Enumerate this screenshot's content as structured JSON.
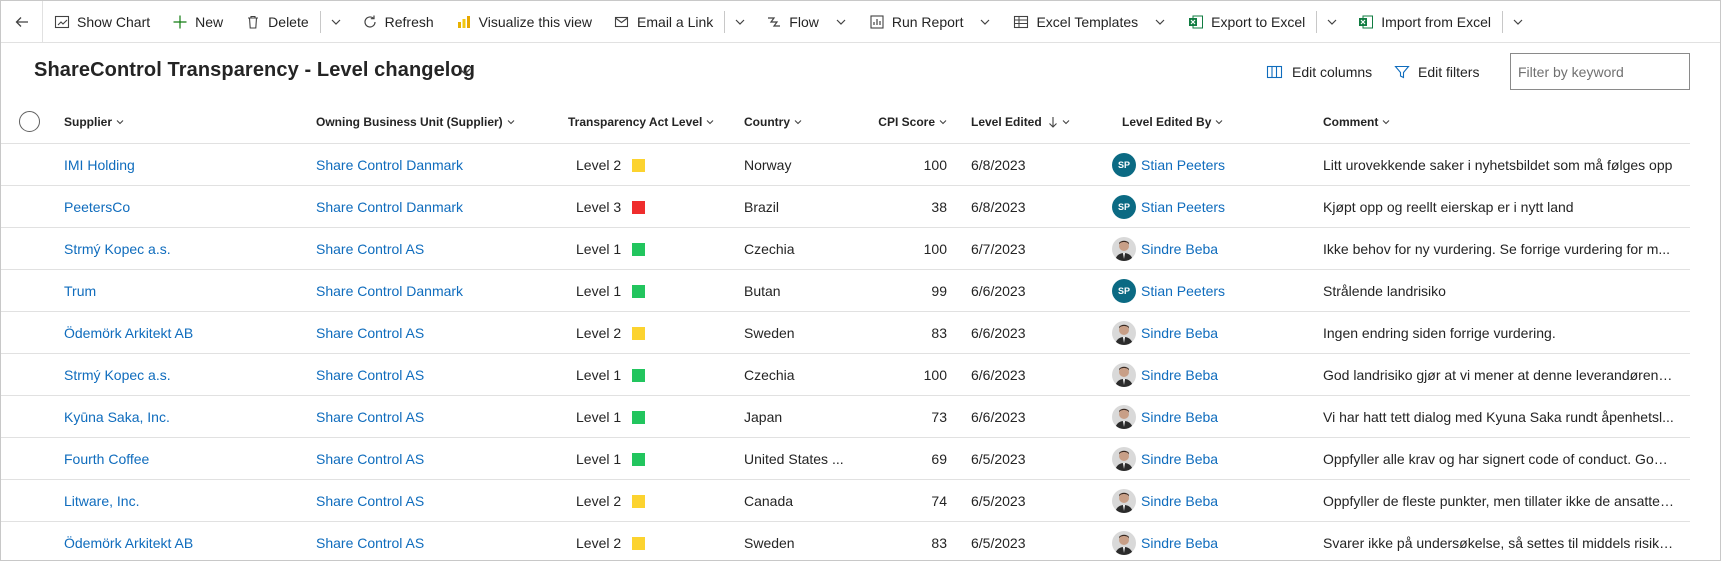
{
  "toolbar": {
    "show_chart": "Show Chart",
    "new": "New",
    "delete": "Delete",
    "refresh": "Refresh",
    "visualize": "Visualize this view",
    "email_link": "Email a Link",
    "flow": "Flow",
    "run_report": "Run Report",
    "excel_templates": "Excel Templates",
    "export_excel": "Export to Excel",
    "import_excel": "Import from Excel"
  },
  "view": {
    "title": "ShareControl Transparency - Level changelog",
    "edit_columns": "Edit columns",
    "edit_filters": "Edit filters",
    "filter_placeholder": "Filter by keyword"
  },
  "columns": {
    "supplier": "Supplier",
    "owning_bu": "Owning Business Unit (Supplier)",
    "level": "Transparency Act Level",
    "country": "Country",
    "cpi": "CPI Score",
    "edited": "Level Edited",
    "edited_by": "Level Edited By",
    "comment": "Comment"
  },
  "colors": {
    "level_1": "#22c55e",
    "level_2": "#fcd32f",
    "level_3": "#ef2d2d",
    "link": "#0f6cbd"
  },
  "rows": [
    {
      "supplier": "IMI Holding",
      "bu": "Share Control Danmark",
      "level": "Level 2",
      "level_color": "#fcd32f",
      "country": "Norway",
      "cpi": "100",
      "edited": "6/8/2023",
      "by": "Stian Peeters",
      "initials": "SP",
      "comment": "Litt urovekkende saker i nyhetsbildet som må følges opp"
    },
    {
      "supplier": "PeetersCo",
      "bu": "Share Control Danmark",
      "level": "Level 3",
      "level_color": "#ef2d2d",
      "country": "Brazil",
      "cpi": "38",
      "edited": "6/8/2023",
      "by": "Stian Peeters",
      "initials": "SP",
      "comment": "Kjøpt opp og reellt eierskap er i nytt land"
    },
    {
      "supplier": "Strmý Kopec a.s.",
      "bu": "Share Control AS",
      "level": "Level 1",
      "level_color": "#22c55e",
      "country": "Czechia",
      "cpi": "100",
      "edited": "6/7/2023",
      "by": "Sindre Beba",
      "initials": "",
      "comment": "Ikke behov for ny vurdering. Se forrige vurdering for m..."
    },
    {
      "supplier": "Trum",
      "bu": "Share Control Danmark",
      "level": "Level 1",
      "level_color": "#22c55e",
      "country": "Butan",
      "cpi": "99",
      "edited": "6/6/2023",
      "by": "Stian Peeters",
      "initials": "SP",
      "comment": "Strålende landrisiko"
    },
    {
      "supplier": "Ödemörk Arkitekt AB",
      "bu": "Share Control AS",
      "level": "Level 2",
      "level_color": "#fcd32f",
      "country": "Sweden",
      "cpi": "83",
      "edited": "6/6/2023",
      "by": "Sindre Beba",
      "initials": "",
      "comment": "Ingen endring siden forrige vurdering."
    },
    {
      "supplier": "Strmý Kopec a.s.",
      "bu": "Share Control AS",
      "level": "Level 1",
      "level_color": "#22c55e",
      "country": "Czechia",
      "cpi": "100",
      "edited": "6/6/2023",
      "by": "Sindre Beba",
      "initials": "",
      "comment": "God landrisiko gjør at vi mener at denne leverandøren i..."
    },
    {
      "supplier": "Kyūna Saka, Inc.",
      "bu": "Share Control AS",
      "level": "Level 1",
      "level_color": "#22c55e",
      "country": "Japan",
      "cpi": "73",
      "edited": "6/6/2023",
      "by": "Sindre Beba",
      "initials": "",
      "comment": "Vi har hatt tett dialog med Kyuna Saka rundt åpenhetsl..."
    },
    {
      "supplier": "Fourth Coffee",
      "bu": "Share Control AS",
      "level": "Level 1",
      "level_color": "#22c55e",
      "country": "United States ...",
      "cpi": "69",
      "edited": "6/5/2023",
      "by": "Sindre Beba",
      "initials": "",
      "comment": "Oppfyller alle krav og har signert code of conduct. God ..."
    },
    {
      "supplier": "Litware, Inc.",
      "bu": "Share Control AS",
      "level": "Level 2",
      "level_color": "#fcd32f",
      "country": "Canada",
      "cpi": "74",
      "edited": "6/5/2023",
      "by": "Sindre Beba",
      "initials": "",
      "comment": "Oppfyller de fleste punkter, men tillater ikke de ansatte ..."
    },
    {
      "supplier": "Ödemörk Arkitekt AB",
      "bu": "Share Control AS",
      "level": "Level 2",
      "level_color": "#fcd32f",
      "country": "Sweden",
      "cpi": "83",
      "edited": "6/5/2023",
      "by": "Sindre Beba",
      "initials": "",
      "comment": "Svarer ikke på undersøkelse, så settes til middels risiko. ..."
    }
  ]
}
